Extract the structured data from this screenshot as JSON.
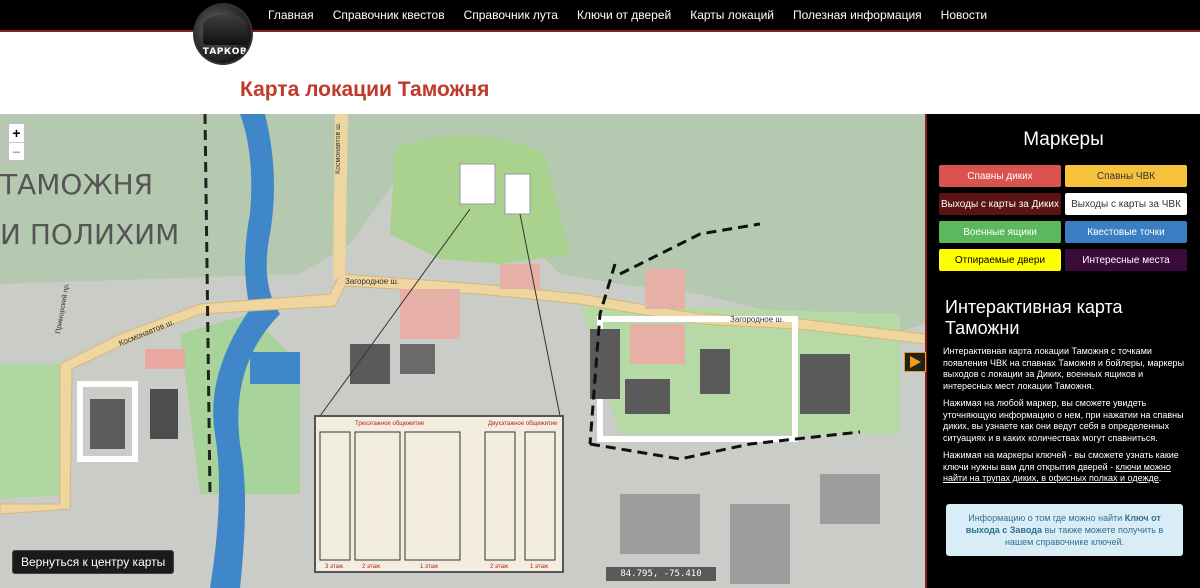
{
  "nav": {
    "logo_text": "ТАРКОВ",
    "items": [
      {
        "label": "Главная"
      },
      {
        "label": "Справочник квестов"
      },
      {
        "label": "Справочник лута"
      },
      {
        "label": "Ключи от дверей"
      },
      {
        "label": "Карты локаций"
      },
      {
        "label": "Полезная информация"
      },
      {
        "label": "Новости"
      }
    ]
  },
  "page": {
    "title": "Карта локации Таможня"
  },
  "map": {
    "zoom_in": "+",
    "zoom_out": "−",
    "recenter_label": "Вернуться к центру карты",
    "coords": "84.795, -75.410",
    "title_line1": "ТАМОЖНЯ",
    "title_line2": "И ПОЛИХИМ",
    "roads": {
      "zagorodnoe_1": "Загородное ш.",
      "zagorodnoe_2": "Загородное ш.",
      "kosmonavtov": "Космонавтов ш.",
      "kosmonavtov_vert": "Космонавтов ш.",
      "primorsky": "Приморский пр."
    },
    "dorm_plan": {
      "title_left": "Трехэтажное общежитие",
      "title_right": "Двухэтажное общежитие",
      "floors": [
        "3 этаж",
        "2 этаж",
        "1 этаж",
        "2 этаж",
        "1 этаж"
      ]
    }
  },
  "sidebar": {
    "markers_title": "Маркеры",
    "buttons": [
      {
        "label": "Спавны диких",
        "bg": "#d9534f",
        "fg": "#ffffff"
      },
      {
        "label": "Спавны ЧВК",
        "bg": "#f6c23e",
        "fg": "#333333"
      },
      {
        "label": "Выходы с карты за Диких",
        "bg": "#5a1414",
        "fg": "#ffffff"
      },
      {
        "label": "Выходы с карты за ЧВК",
        "bg": "#ffffff",
        "fg": "#333333"
      },
      {
        "label": "Военные ящики",
        "bg": "#5cb85c",
        "fg": "#ffffff"
      },
      {
        "label": "Квестовые точки",
        "bg": "#3a7fc4",
        "fg": "#ffffff"
      },
      {
        "label": "Отпираемые двери",
        "bg": "#ffff00",
        "fg": "#000000"
      },
      {
        "label": "Интересные места",
        "bg": "#3b0b3b",
        "fg": "#ffffff"
      }
    ],
    "info_title_line1": "Интерактивная карта",
    "info_title_line2": "Таможни",
    "p1": "Интерактивная карта локации Таможня с точками появления ЧВК на спавнах Таможня и бойлеры, маркеры выходов с локации за Диких, военных ящиков и интересных мест локации Таможня.",
    "p2": "Нажимая на любой маркер, вы сможете увидеть уточняющую информацию о нем, при нажатии на спавны диких, вы узнаете как они ведут себя в определенных ситуациях и в каких количествах могут спавниться.",
    "p3_start": "Нажимая на маркеры ключей - вы сможете узнать какие ключи нужны вам для открытия дверей - ",
    "p3_link": "ключи можно найти на трупах диких, в офисных полках и одежде",
    "p3_end": ".",
    "notice_start": "Информацию о том где можно найти ",
    "notice_bold": "Ключ от выхода с Завода",
    "notice_end": " вы также можете получить в нашем справочнике ключей."
  }
}
